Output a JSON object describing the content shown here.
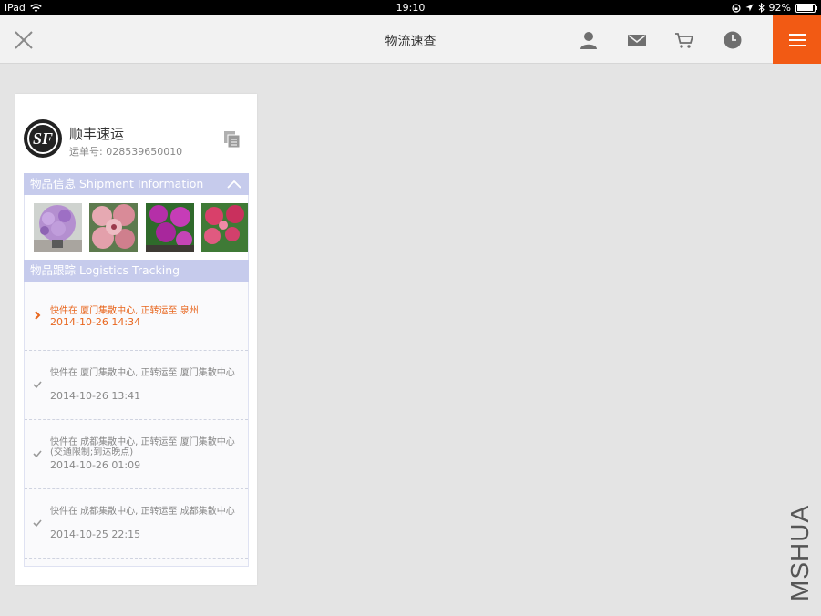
{
  "status_bar": {
    "device": "iPad",
    "time": "19:10",
    "battery": "92%",
    "battery_level": 0.92
  },
  "nav": {
    "title": "物流速查",
    "icons": [
      "close-icon",
      "user-icon",
      "mail-icon",
      "cart-icon",
      "clock-icon",
      "menu-icon"
    ],
    "accent_color": "#f25a14"
  },
  "carrier": {
    "name": "顺丰速运",
    "tracking_no": "运单号: 028539650010",
    "logo_text": "SF"
  },
  "shipment_section": {
    "title": "物品信息 Shipment Information",
    "photos": [
      "purple-flower-pot",
      "pink-flowers",
      "magenta-flowers",
      "red-flowers"
    ]
  },
  "tracking_section": {
    "title": "物品跟踪 Logistics Tracking",
    "events": [
      {
        "desc": "快件在 厦门集散中心, 正转运至 泉州",
        "date": "2014-10-26 14:34",
        "current": true
      },
      {
        "desc": "快件在 厦门集散中心, 正转运至 厦门集散中心",
        "date": "2014-10-26 13:41",
        "current": false
      },
      {
        "desc": "快件在 成都集散中心, 正转运至 厦门集散中心(交通限制;到达晚点)",
        "date": "2014-10-26 01:09",
        "current": false
      },
      {
        "desc": "快件在 成都集散中心, 正转运至 成都集散中心",
        "date": "2014-10-25 22:15",
        "current": false
      }
    ]
  },
  "watermark": "MSHUA"
}
